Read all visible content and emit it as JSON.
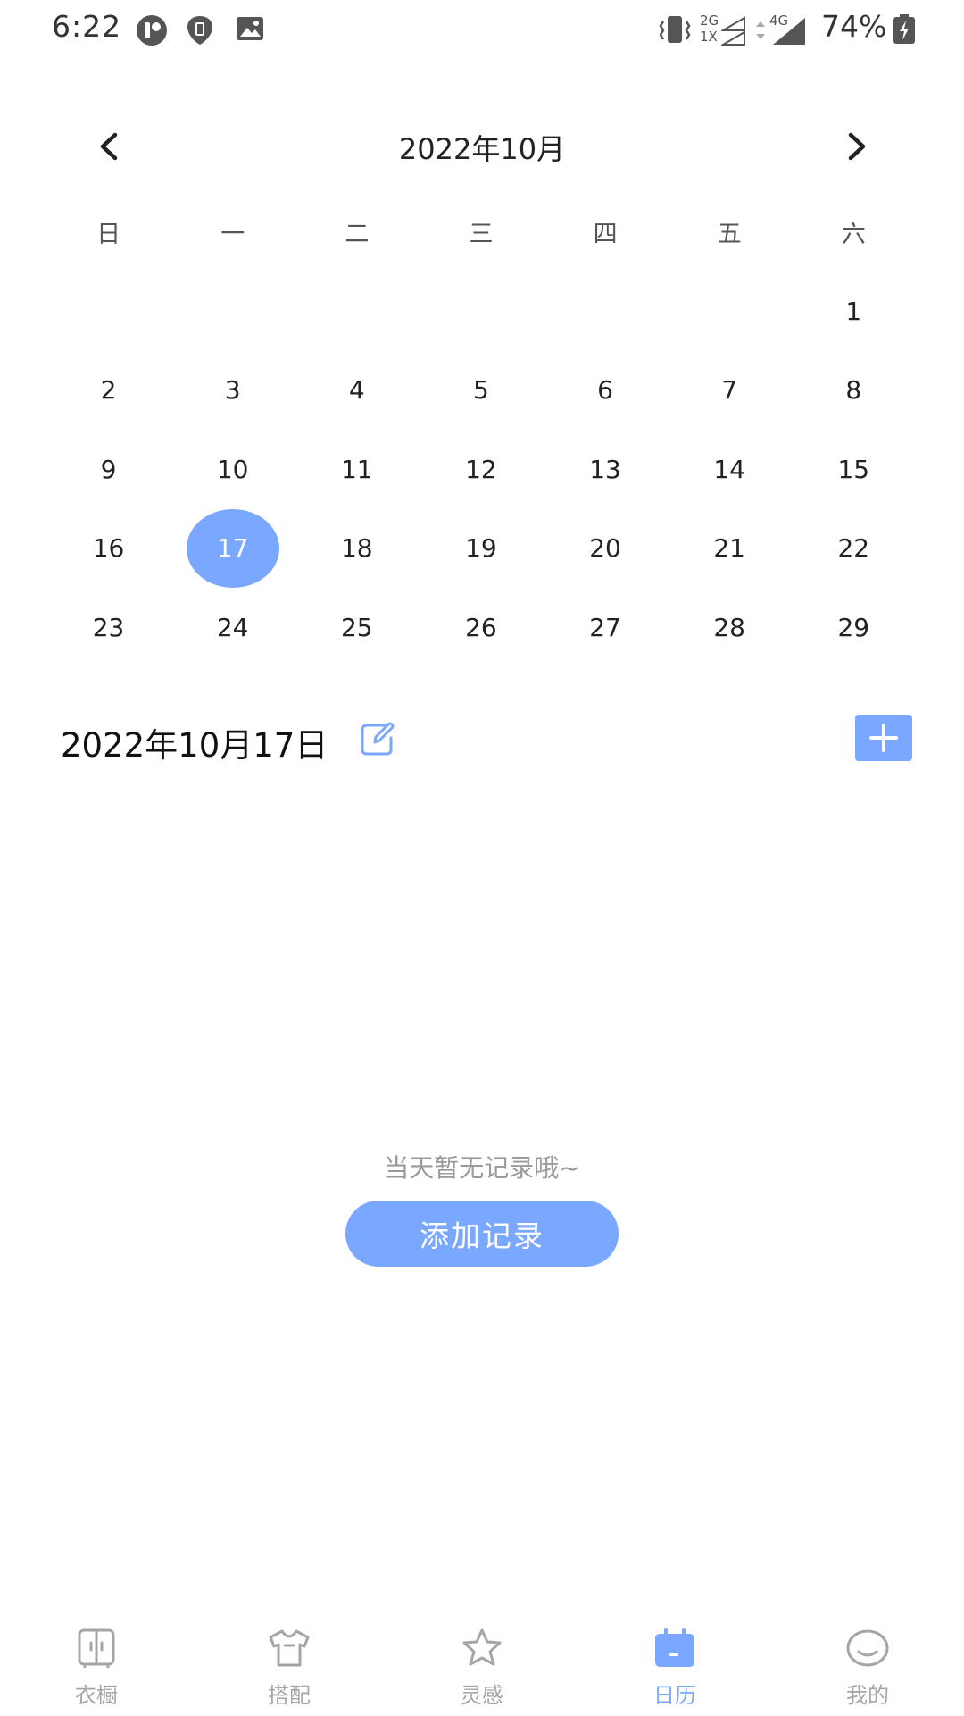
{
  "status_bar": {
    "time": "6:22",
    "battery_percent": "74%",
    "network_2g_top": "2G",
    "network_2g_bottom": "1X",
    "network_4g": "4G",
    "icons": [
      "user-circle-icon",
      "shield-icon",
      "image-icon",
      "vibrate-icon",
      "signal-2g-icon",
      "signal-4g-icon",
      "battery-charging-icon"
    ]
  },
  "calendar": {
    "month_title": "2022年10月",
    "prev_icon": "chevron-left-icon",
    "next_icon": "chevron-right-icon",
    "weekdays": [
      "日",
      "一",
      "二",
      "三",
      "四",
      "五",
      "六"
    ],
    "leading_empty": 6,
    "days": [
      1,
      2,
      3,
      4,
      5,
      6,
      7,
      8,
      9,
      10,
      11,
      12,
      13,
      14,
      15,
      16,
      17,
      18,
      19,
      20,
      21,
      22,
      23,
      24,
      25,
      26,
      27,
      28,
      29
    ],
    "selected_day": 17
  },
  "selected_date": {
    "label": "2022年10月17日",
    "edit_icon": "edit-note-icon",
    "add_icon": "plus-icon"
  },
  "empty_state": {
    "message": "当天暂无记录哦~",
    "button_label": "添加记录"
  },
  "tab_bar": {
    "tabs": [
      {
        "label": "衣橱",
        "icon": "wardrobe-icon",
        "active": false
      },
      {
        "label": "搭配",
        "icon": "shirt-icon",
        "active": false
      },
      {
        "label": "灵感",
        "icon": "star-icon",
        "active": false
      },
      {
        "label": "日历",
        "icon": "calendar-icon",
        "active": true
      },
      {
        "label": "我的",
        "icon": "profile-face-icon",
        "active": false
      }
    ]
  },
  "colors": {
    "accent": "#7aa7ff",
    "inactive": "#a5a5a5",
    "text": "#222222",
    "muted": "#9a9a9a"
  }
}
